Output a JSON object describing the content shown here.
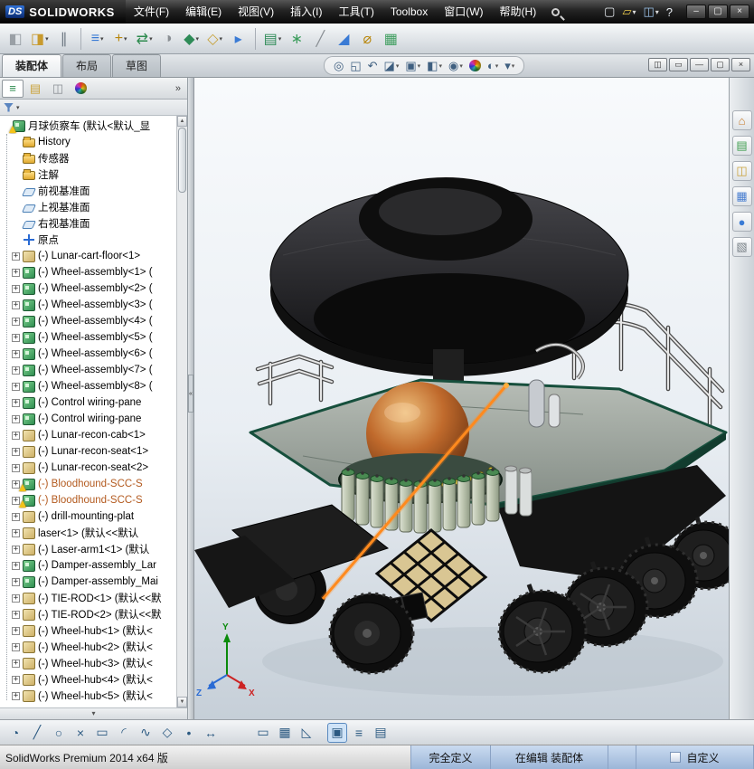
{
  "title_bar": {
    "logo_prefix": "DS",
    "logo": "SOLIDWORKS",
    "menus": [
      "文件(F)",
      "编辑(E)",
      "视图(V)",
      "插入(I)",
      "工具(T)",
      "Toolbox",
      "窗口(W)",
      "帮助(H)"
    ],
    "quick_access": [
      {
        "name": "new-document-icon",
        "glyph": "▢",
        "color": "#e8edf2"
      },
      {
        "name": "open-icon",
        "glyph": "▱",
        "color": "#e8c84a",
        "dd": true
      },
      {
        "name": "save-icon",
        "glyph": "◫",
        "color": "#9cc3ea",
        "dd": true
      },
      {
        "name": "help-icon",
        "glyph": "?",
        "color": "#e8edf2"
      }
    ],
    "window_buttons": [
      {
        "name": "minimize-button",
        "glyph": "–"
      },
      {
        "name": "maximize-button",
        "glyph": "▢"
      },
      {
        "name": "close-button",
        "glyph": "×"
      }
    ]
  },
  "toolbar": {
    "icons": [
      {
        "name": "edit-component-icon",
        "glyph": "◧",
        "color": "#9aa0a6"
      },
      {
        "name": "insert-components-icon",
        "glyph": "◨",
        "color": "#c89a2e",
        "dd": true
      },
      {
        "name": "mate-icon",
        "glyph": "∥",
        "color": "#6f7a84"
      },
      {
        "sep": true
      },
      {
        "name": "linear-component-pattern-icon",
        "glyph": "≡",
        "color": "#3a7bd5",
        "dd": true
      },
      {
        "name": "smart-fasteners-icon",
        "glyph": "+",
        "color": "#b8860b",
        "dd": true
      },
      {
        "name": "move-component-icon",
        "glyph": "⇄",
        "color": "#2e8b4f",
        "dd": true
      },
      {
        "name": "show-hidden-components-icon",
        "glyph": "◑",
        "color": "#8a8f94"
      },
      {
        "name": "assembly-features-icon",
        "glyph": "◆",
        "color": "#2e8b57",
        "dd": true
      },
      {
        "name": "reference-geometry-icon",
        "glyph": "◇",
        "color": "#c7a23a",
        "dd": true
      },
      {
        "name": "new-motion-study-icon",
        "glyph": "▸",
        "color": "#3a7bd5"
      },
      {
        "sep": true
      },
      {
        "name": "bill-of-materials-icon",
        "glyph": "▤",
        "color": "#2e8b57",
        "dd": true
      },
      {
        "name": "exploded-view-icon",
        "glyph": "∗",
        "color": "#3f9e5f"
      },
      {
        "name": "explode-line-sketch-icon",
        "glyph": "╱",
        "color": "#8a8f94"
      },
      {
        "name": "interference-detection-icon",
        "glyph": "◢",
        "color": "#3a7bd5"
      },
      {
        "name": "measure-icon",
        "glyph": "⌀",
        "color": "#b8860b"
      },
      {
        "name": "mass-properties-icon",
        "glyph": "▦",
        "color": "#3f9e5f"
      }
    ]
  },
  "tabs": [
    {
      "name": "tab-assembly",
      "label": "装配体",
      "active": true
    },
    {
      "name": "tab-layout",
      "label": "布局"
    },
    {
      "name": "tab-sketch",
      "label": "草图"
    }
  ],
  "headsup": {
    "icons": [
      {
        "name": "zoom-to-fit-icon",
        "glyph": "◎"
      },
      {
        "name": "zoom-to-area-icon",
        "glyph": "◱"
      },
      {
        "name": "previous-view-icon",
        "glyph": "↶"
      },
      {
        "name": "section-view-icon",
        "glyph": "◪",
        "dd": true
      },
      {
        "name": "view-orientation-icon",
        "glyph": "▣",
        "dd": true
      },
      {
        "name": "display-style-icon",
        "glyph": "◧",
        "dd": true
      },
      {
        "name": "hide-show-items-icon",
        "glyph": "◉",
        "dd": true
      },
      {
        "name": "edit-appearance-icon",
        "ball": true
      },
      {
        "name": "apply-scene-icon",
        "glyph": "◐",
        "dd": true
      },
      {
        "name": "view-settings-icon",
        "glyph": "▾",
        "dd": true
      }
    ]
  },
  "doc_controls": [
    {
      "name": "pane-split-icon",
      "glyph": "◫"
    },
    {
      "name": "pane-horizontal-icon",
      "glyph": "▭"
    },
    {
      "name": "doc-minimize-button",
      "glyph": "—"
    },
    {
      "name": "doc-restore-button",
      "glyph": "▢"
    },
    {
      "name": "doc-close-button",
      "glyph": "×"
    }
  ],
  "left_panel": {
    "tabs": [
      {
        "name": "featuremanager-tab",
        "glyph": "≡",
        "color": "#2e8b4f",
        "active": true
      },
      {
        "name": "propertymanager-tab",
        "glyph": "▤",
        "color": "#c9a23a"
      },
      {
        "name": "configurationmanager-tab",
        "glyph": "◫",
        "color": "#8a8f94"
      },
      {
        "name": "appearancemanager-tab",
        "ball": true
      }
    ],
    "overflow": "»",
    "glyphs": {
      "expander": "+",
      "dropdown": "▾",
      "collapse": "«",
      "scroll_up": "▲",
      "scroll_down": "▼",
      "panel_more": "▾"
    },
    "tree": {
      "root": {
        "text": "月球侦察车 (默认<默认_显",
        "type": "assembly",
        "warn": true
      },
      "items": [
        {
          "text": "History",
          "type": "folder-history"
        },
        {
          "text": "传感器",
          "type": "folder-sensor"
        },
        {
          "text": "注解",
          "type": "folder-annotations"
        },
        {
          "text": "前视基准面",
          "type": "plane"
        },
        {
          "text": "上视基准面",
          "type": "plane"
        },
        {
          "text": "右视基准面",
          "type": "plane"
        },
        {
          "text": "原点",
          "type": "origin"
        },
        {
          "text": "(-) Lunar-cart-floor<1>",
          "type": "part",
          "expand": true
        },
        {
          "text": "(-) Wheel-assembly<1> (",
          "type": "assembly",
          "expand": true
        },
        {
          "text": "(-) Wheel-assembly<2> (",
          "type": "assembly",
          "expand": true
        },
        {
          "text": "(-) Wheel-assembly<3> (",
          "type": "assembly",
          "expand": true
        },
        {
          "text": "(-) Wheel-assembly<4> (",
          "type": "assembly",
          "expand": true
        },
        {
          "text": "(-) Wheel-assembly<5> (",
          "type": "assembly",
          "expand": true
        },
        {
          "text": "(-) Wheel-assembly<6> (",
          "type": "assembly",
          "expand": true
        },
        {
          "text": "(-) Wheel-assembly<7> (",
          "type": "assembly",
          "expand": true
        },
        {
          "text": "(-) Wheel-assembly<8> (",
          "type": "assembly",
          "expand": true
        },
        {
          "text": "(-) Control wiring-pane",
          "type": "assembly",
          "expand": true
        },
        {
          "text": "(-) Control wiring-pane",
          "type": "assembly",
          "expand": true
        },
        {
          "text": "(-) Lunar-recon-cab<1>",
          "type": "part",
          "expand": true
        },
        {
          "text": "(-) Lunar-recon-seat<1>",
          "type": "part",
          "expand": true
        },
        {
          "text": "(-) Lunar-recon-seat<2>",
          "type": "part",
          "expand": true
        },
        {
          "text": "(-) Bloodhound-SCC-S",
          "type": "assembly",
          "expand": true,
          "warn": true,
          "color": "#b35a1f"
        },
        {
          "text": "(-) Bloodhound-SCC-S",
          "type": "assembly",
          "expand": true,
          "warn": true,
          "color": "#b35a1f"
        },
        {
          "text": "(-) drill-mounting-plat",
          "type": "part",
          "expand": true
        },
        {
          "text": "laser<1> (默认<<默认",
          "type": "part",
          "expand": true
        },
        {
          "text": "(-) Laser-arm1<1> (默认",
          "type": "part",
          "expand": true
        },
        {
          "text": "(-) Damper-assembly_Lar",
          "type": "assembly",
          "expand": true
        },
        {
          "text": "(-) Damper-assembly_Mai",
          "type": "assembly",
          "expand": true
        },
        {
          "text": "(-) TIE-ROD<1> (默认<<默",
          "type": "part",
          "expand": true
        },
        {
          "text": "(-) TIE-ROD<2> (默认<<默",
          "type": "part",
          "expand": true
        },
        {
          "text": "(-) Wheel-hub<1> (默认<",
          "type": "part",
          "expand": true
        },
        {
          "text": "(-) Wheel-hub<2> (默认<",
          "type": "part",
          "expand": true
        },
        {
          "text": "(-) Wheel-hub<3> (默认<",
          "type": "part",
          "expand": true
        },
        {
          "text": "(-) Wheel-hub<4> (默认<",
          "type": "part",
          "expand": true
        },
        {
          "text": "(-) Wheel-hub<5> (默认<",
          "type": "part",
          "expand": true
        }
      ]
    }
  },
  "right_panel": {
    "icons": [
      {
        "name": "home-icon",
        "glyph": "⌂",
        "color": "#c77b2a"
      },
      {
        "name": "design-library-icon",
        "glyph": "▤",
        "color": "#3f9e4f"
      },
      {
        "name": "file-explorer-icon",
        "glyph": "◫",
        "color": "#c9a23a"
      },
      {
        "name": "view-palette-icon",
        "glyph": "▦",
        "color": "#4a7fd1"
      },
      {
        "name": "appearances-icon",
        "glyph": "●",
        "color": "#3a7bd5"
      },
      {
        "name": "custom-properties-icon",
        "glyph": "▧",
        "color": "#7a8288"
      }
    ]
  },
  "sketchbar": {
    "groups": [
      [
        {
          "name": "instant2d-icon",
          "glyph": "◔"
        },
        {
          "name": "line-icon",
          "glyph": "╱"
        },
        {
          "name": "circle-icon",
          "glyph": "○"
        },
        {
          "name": "centerpoint-arc-icon",
          "glyph": "×"
        },
        {
          "name": "corner-rectangle-icon",
          "glyph": "▭"
        },
        {
          "name": "arc-icon",
          "glyph": "◜"
        },
        {
          "name": "spline-icon",
          "glyph": "∿"
        },
        {
          "name": "polygon-icon",
          "glyph": "◇"
        },
        {
          "name": "point-icon",
          "glyph": "•"
        },
        {
          "name": "smart-dimension-icon",
          "glyph": "↔"
        }
      ],
      [
        {
          "name": "selection-box-icon",
          "glyph": "▭"
        },
        {
          "name": "grid-snap-icon",
          "glyph": "▦"
        },
        {
          "name": "ruler-icon",
          "glyph": "◺"
        }
      ],
      [
        {
          "name": "viewport-pane-icon",
          "glyph": "▣",
          "active": true
        },
        {
          "name": "task-list-icon",
          "glyph": "≡"
        },
        {
          "name": "sheet-grid-icon",
          "glyph": "▤"
        }
      ]
    ]
  },
  "status_bar": {
    "left": "SolidWorks Premium 2014 x64 版",
    "fully_defined": "完全定义",
    "editing": "在编辑 装配体",
    "custom": "自定义"
  },
  "viewport": {
    "triad": {
      "x": "X",
      "y": "Y",
      "z": "Z"
    }
  }
}
